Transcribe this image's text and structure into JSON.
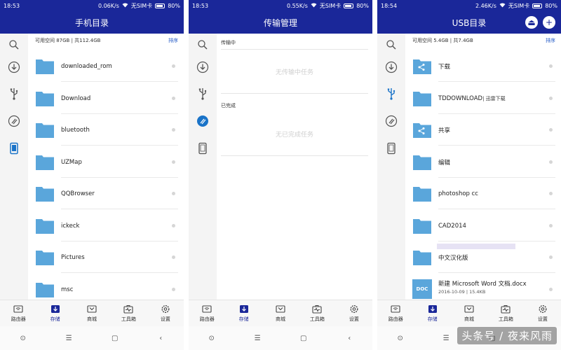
{
  "colors": {
    "brand": "#1a2799",
    "folder": "#5aa6db",
    "accent": "#2a5fc8",
    "sidebar_active": "#1a73c8"
  },
  "phone1": {
    "status": {
      "time": "18:53",
      "speed": "0.06K/s",
      "sim": "无SIM卡",
      "battery": "80%"
    },
    "title": "手机目录",
    "space": "可用空间 87GB | 共112.4GB",
    "sort": "排序",
    "items": [
      {
        "name": "downloaded_rom"
      },
      {
        "name": "Download"
      },
      {
        "name": "bluetooth"
      },
      {
        "name": "UZMap"
      },
      {
        "name": "QQBrowser"
      },
      {
        "name": "ickeck"
      },
      {
        "name": "Pictures"
      },
      {
        "name": "msc"
      }
    ]
  },
  "phone2": {
    "status": {
      "time": "18:53",
      "speed": "0.55K/s",
      "sim": "无SIM卡",
      "battery": "80%"
    },
    "title": "传输管理",
    "transferring_header": "传输中",
    "transferring_empty": "无传输中任务",
    "done_header": "已完成",
    "done_empty": "无已完成任务"
  },
  "phone3": {
    "status": {
      "time": "18:54",
      "speed": "2.46K/s",
      "sim": "无SIM卡",
      "battery": "80%"
    },
    "title": "USB目录",
    "space": "可用空间 5.4GB | 共7.4GB",
    "sort": "排序",
    "items": [
      {
        "name": "下载"
      },
      {
        "name": "TDDOWNLOAD",
        "suffix": " | 迅雷下载"
      },
      {
        "name": "共享"
      },
      {
        "name": "编辑"
      },
      {
        "name": "photoshop cc"
      },
      {
        "name": "CAD2014"
      },
      {
        "name": "中文汉化版"
      },
      {
        "name": "新建 Microsoft Word 文档.docx",
        "meta": "2016-10-09 | 15.4KB",
        "badge": "DOC"
      }
    ]
  },
  "tabs": [
    {
      "label": "路由器",
      "icon": "router-icon"
    },
    {
      "label": "存储",
      "icon": "storage-icon"
    },
    {
      "label": "商城",
      "icon": "shop-icon"
    },
    {
      "label": "工具箱",
      "icon": "toolbox-icon"
    },
    {
      "label": "设置",
      "icon": "settings-icon"
    }
  ],
  "watermark": "头条号 / 夜来风雨"
}
